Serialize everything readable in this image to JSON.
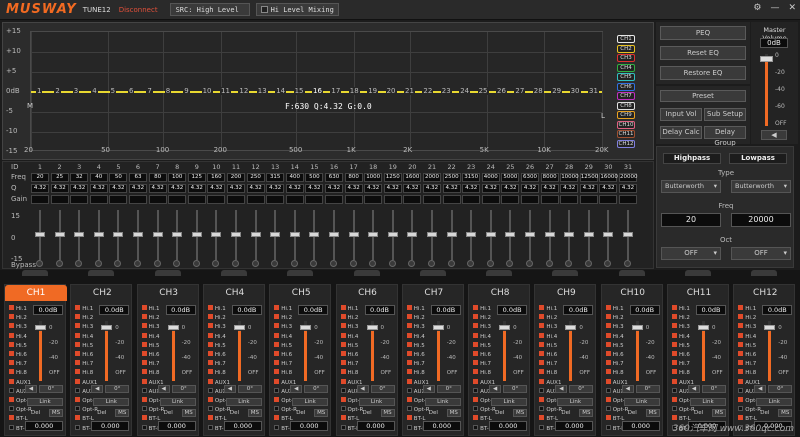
{
  "titlebar": {
    "logo": "MUSWAY",
    "model": "TUNE12",
    "status": "Disconnect",
    "src": "SRC: High Level",
    "hl_mixing": "Hi Level Mixing"
  },
  "graph": {
    "y_labels": [
      "+15",
      "+10",
      "+5",
      "0dB",
      "-5",
      "-10",
      "-15"
    ],
    "x_labels": [
      "20",
      "50",
      "100",
      "200",
      "500",
      "1K",
      "2K",
      "5K",
      "10K",
      "20K"
    ],
    "band_markers": [
      "1",
      "2",
      "3",
      "4",
      "5",
      "6",
      "7",
      "8",
      "9",
      "10",
      "11",
      "12",
      "13",
      "14",
      "15",
      "16",
      "17",
      "18",
      "19",
      "20",
      "21",
      "22",
      "23",
      "24",
      "25",
      "26",
      "27",
      "28",
      "29",
      "30",
      "31"
    ],
    "selected_info": "F:630 Q:4.32 G:0.0",
    "left_marker": "M",
    "right_marker": "L",
    "channels": [
      {
        "label": "CH1",
        "color": "#e8e8e8"
      },
      {
        "label": "CH2",
        "color": "#e8c020"
      },
      {
        "label": "CH3",
        "color": "#e03030"
      },
      {
        "label": "CH4",
        "color": "#30b040"
      },
      {
        "label": "CH5",
        "color": "#30c0c0"
      },
      {
        "label": "CH6",
        "color": "#3070e0"
      },
      {
        "label": "CH7",
        "color": "#c030c0"
      },
      {
        "label": "CH8",
        "color": "#e0e0e0"
      },
      {
        "label": "CH9",
        "color": "#e8a020"
      },
      {
        "label": "CH10",
        "color": "#e06080"
      },
      {
        "label": "CH11",
        "color": "#a05030"
      },
      {
        "label": "CH12",
        "color": "#8080e0"
      }
    ]
  },
  "params": {
    "row_labels": {
      "id": "ID",
      "freq": "Freq",
      "q": "Q",
      "gain": "Gain",
      "plus15": "15",
      "zero": "0",
      "minus15": "-15",
      "bypass": "Bypass"
    },
    "freqs": [
      "20",
      "25",
      "32",
      "40",
      "50",
      "63",
      "80",
      "100",
      "125",
      "160",
      "200",
      "250",
      "315",
      "400",
      "500",
      "630",
      "800",
      "1000",
      "1250",
      "1600",
      "2000",
      "2500",
      "3150",
      "4000",
      "5000",
      "6300",
      "8000",
      "10000",
      "12500",
      "16000",
      "20000"
    ],
    "q": "4.32",
    "gain": "0.0"
  },
  "right": {
    "peq": "PEQ",
    "reset_eq": "Reset EQ",
    "restore_eq": "Restore EQ",
    "preset": "Preset",
    "input_vol": "Input Vol",
    "sub_setup": "Sub Setup",
    "delay_calc": "Delay Calc",
    "delay_group": "Delay Group",
    "highpass": "Highpass",
    "lowpass": "Lowpass",
    "type_label": "Type",
    "hp_type": "Butterworth",
    "lp_type": "Butterworth",
    "freq_label": "Freq",
    "hp_freq": "20",
    "lp_freq": "20000",
    "oct_label": "Oct",
    "hp_oct": "OFF",
    "lp_oct": "OFF"
  },
  "master": {
    "title": "Master Volume",
    "value": "0dB",
    "ticks": [
      "0",
      "-20",
      "-40",
      "-60",
      "OFF"
    ]
  },
  "strips": {
    "inputs": [
      "Hi.1",
      "Hi.2",
      "Hi.3",
      "Hi.4",
      "Hi.5",
      "Hi.6",
      "Hi.7",
      "Hi.8",
      "AUX1",
      "AUX2",
      "Opt-L",
      "Opt-R",
      "BT-L",
      "BT-R"
    ],
    "gain": "0.0dB",
    "ticks": [
      "0",
      "-20",
      "-40",
      "OFF"
    ],
    "phase": "0°",
    "link": "Link",
    "del": "Del",
    "ms": "MS",
    "delay": "0.000",
    "channels": [
      "CH1",
      "CH2",
      "CH3",
      "CH4",
      "CH5",
      "CH6",
      "CH7",
      "CH8",
      "CH9",
      "CH10",
      "CH11",
      "CH12"
    ]
  },
  "watermark": "360汽车网 www.360qc.com"
}
